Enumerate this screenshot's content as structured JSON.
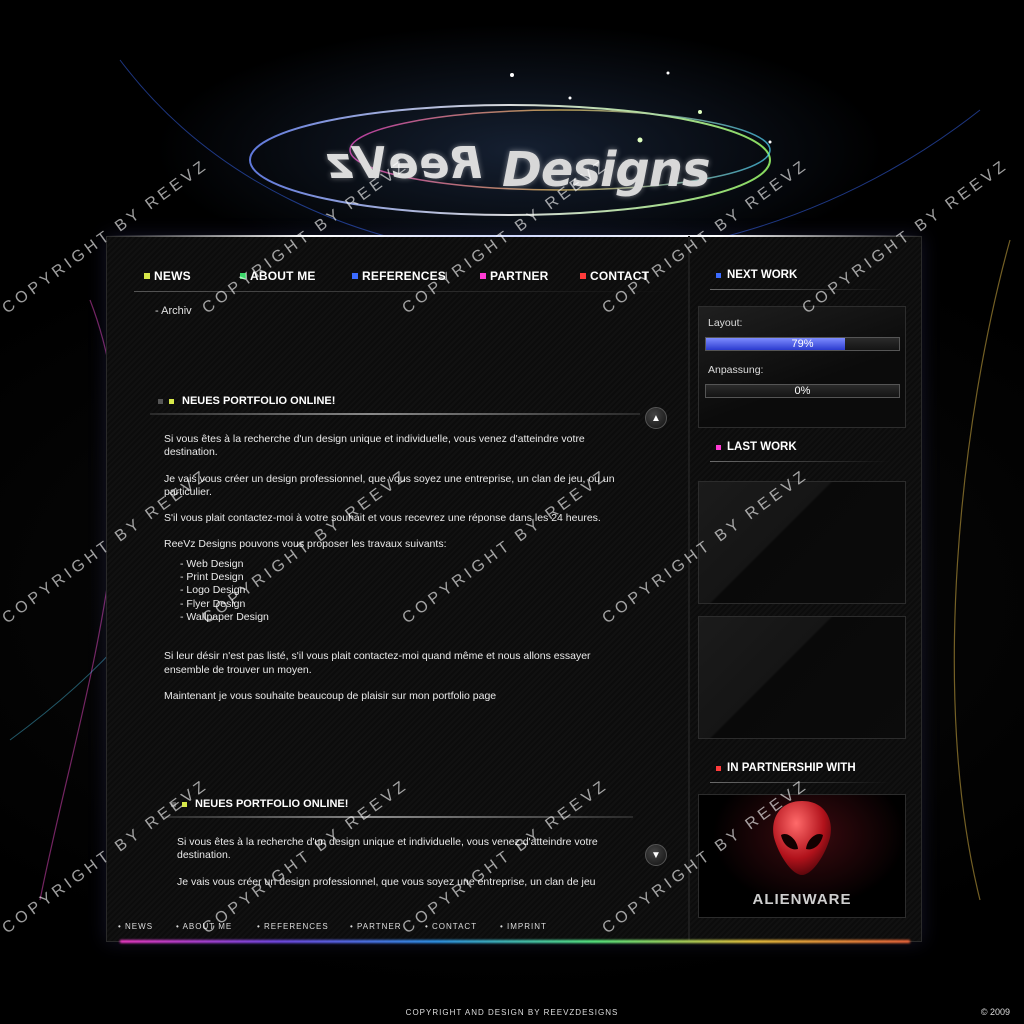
{
  "logo": {
    "mirror_text": "ReeVz",
    "designs_text": "Designs"
  },
  "nav": {
    "items": [
      {
        "label": "NEWS",
        "color": "#d7e84a"
      },
      {
        "label": "ABOUT ME",
        "color": "#3bd86a"
      },
      {
        "label": "REFERENCES",
        "color": "#3b6bff"
      },
      {
        "label": "PARTNER",
        "color": "#ff3bd4"
      },
      {
        "label": "CONTACT",
        "color": "#ff3b3b"
      }
    ]
  },
  "archive_link": "- Archiv",
  "articles": [
    {
      "title": "NEUES PORTFOLIO ONLINE!",
      "paragraphs": [
        "Si vous êtes à la recherche d'un design unique et individuelle, vous venez d'atteindre votre destination.",
        "Je vais vous créer un design professionnel, que vous soyez une entreprise, un clan de jeu, ou un particulier.",
        "S'il vous plait contactez-moi à votre souhait et vous recevrez une réponse dans les 24 heures.",
        "ReeVz Designs pouvons vous proposer les travaux suivants:"
      ],
      "services": [
        "- Web Design",
        "- Print Design",
        "- Logo Design",
        "- Flyer Design",
        "- Wallpaper Design"
      ],
      "closing": [
        "Si leur désir n'est pas listé, s'il vous plait contactez-moi quand même et nous allons essayer ensemble de trouver un moyen.",
        "Maintenant je vous souhaite beaucoup de plaisir sur mon portfolio page"
      ]
    },
    {
      "title": "NEUES PORTFOLIO ONLINE!",
      "paragraphs": [
        "Si vous êtes à la recherche d'un design unique et individuelle, vous venez d'atteindre votre destination.",
        "Je vais vous créer un design professionnel, que vous soyez une entreprise, un clan de jeu"
      ]
    }
  ],
  "footer_nav": [
    "• NEWS",
    "• ABOUT ME",
    "• REFERENCES",
    "• PARTNER",
    "• CONTACT",
    "• IMPRINT"
  ],
  "sidebar": {
    "next_work": {
      "title": "NEXT WORK",
      "marker_color": "#3b6bff",
      "progress": [
        {
          "label": "Layout:",
          "value_text": "79%",
          "value": 0.72
        },
        {
          "label": "Anpassung:",
          "value_text": "0%",
          "value": 0
        }
      ]
    },
    "last_work": {
      "title": "LAST WORK",
      "marker_color": "#ff3bd4"
    },
    "partnership": {
      "title": "IN PARTNERSHIP WITH",
      "marker_color": "#ff3b3b",
      "partner_name": "ALIENWARE"
    }
  },
  "watermark": "COPYRIGHT BY REEVZ",
  "footer": {
    "copyright": "COPYRIGHT AND DESIGN BY REEVZDESIGNS",
    "year": "© 2009"
  }
}
